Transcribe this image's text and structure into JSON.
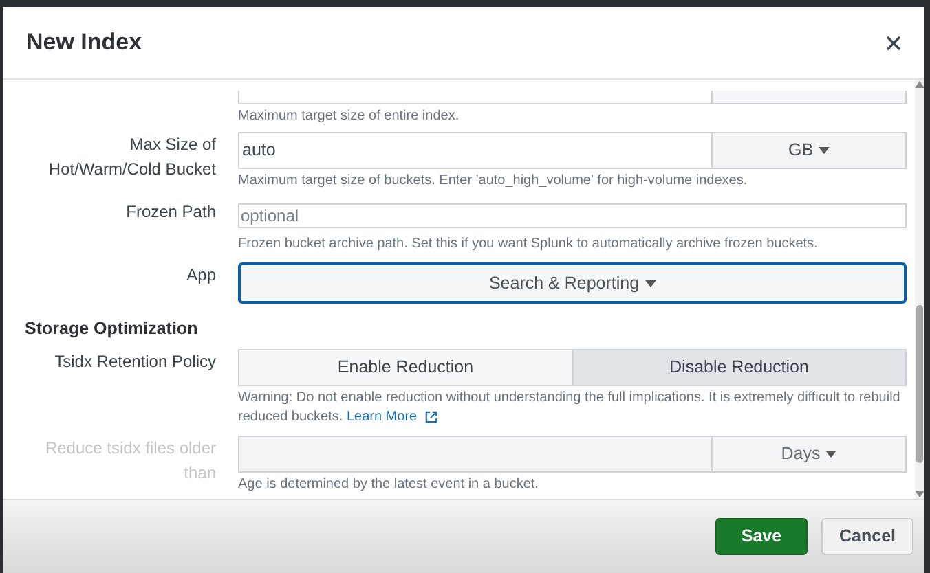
{
  "dialog": {
    "title": "New Index"
  },
  "fields": [
    {
      "kind": "stub",
      "help": "Maximum target size of entire index."
    },
    {
      "kind": "input_unit",
      "label_lines": [
        "Max Size of",
        "Hot/Warm/Cold Bucket"
      ],
      "value": "auto",
      "unit": "GB",
      "disabled": false,
      "help": "Maximum target size of buckets. Enter 'auto_high_volume' for high-volume indexes."
    },
    {
      "kind": "input",
      "label_lines": [
        "Frozen Path"
      ],
      "placeholder": "optional",
      "disabled": false,
      "help": "Frozen bucket archive path. Set this if you want Splunk to automatically archive frozen buckets."
    },
    {
      "kind": "select",
      "label_lines": [
        "App"
      ],
      "value": "Search & Reporting",
      "focused": true,
      "disabled": false
    },
    {
      "kind": "heading",
      "text": "Storage Optimization"
    },
    {
      "kind": "segmented",
      "label_lines": [
        "Tsidx Retention Policy"
      ],
      "options": [
        {
          "label": "Enable Reduction",
          "selected": false
        },
        {
          "label": "Disable Reduction",
          "selected": true
        }
      ],
      "disabled": false,
      "help": "Warning: Do not enable reduction without understanding the full implications. It is extremely difficult to rebuild reduced buckets.",
      "link": "Learn More"
    },
    {
      "kind": "input_unit",
      "label_lines": [
        "Reduce tsidx files older",
        "than"
      ],
      "unit": "Days",
      "disabled": true,
      "help": "Age is determined by the latest event in a bucket."
    }
  ],
  "buttons": [
    {
      "label": "Save",
      "kind": "primary"
    },
    {
      "label": "Cancel",
      "kind": "secondary"
    }
  ]
}
